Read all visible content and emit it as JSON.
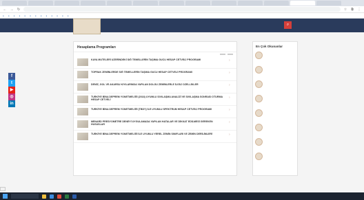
{
  "browser": {
    "tabs": [
      "",
      "",
      "",
      "",
      "",
      "",
      "",
      "",
      "",
      "",
      "",
      "",
      ""
    ],
    "active_tab": 11,
    "url": "",
    "bookmarks": [
      "",
      "",
      "",
      "",
      "",
      "",
      "",
      "",
      "",
      "",
      "",
      "",
      ""
    ]
  },
  "site": {
    "logo_text": "",
    "menu": [
      "",
      "",
      "",
      "",
      "",
      "",
      ""
    ],
    "search_icon": "search-icon",
    "breadcrumb": ""
  },
  "main": {
    "title": "Hesaplama Programları",
    "filter_label": "",
    "sort_a": "",
    "sort_b": "",
    "items": [
      {
        "title": "KAYA MÜTELERİ ÜZERİNDEKİ SIĞ TEMELLERİN TAŞIMA GÜCÜ HESAP CETVELİ PROGRAMI",
        "date": ""
      },
      {
        "title": "TOPRAK ZEMİNLERDE SIĞ TEMELLERİN TAŞIMA GÜCÜ HESAP CETVELİ PROGRAMI",
        "date": ""
      },
      {
        "title": "DENİZ, GÖL VE AKARSU KIYILARINDA YAPILAN DOLGU ZEMİNLERLE İLGİLİ ÖZELLİKLER",
        "date": ""
      },
      {
        "title": "TÜRKİYE BİNA DEPREM YÖNETMELİĞİ (2018) UYUMLU SIVILAŞMA ANALİZİ VE SIVILAŞMA SONRASI OTURMA HESAP CETVELİ",
        "date": ""
      },
      {
        "title": "TÜRKİYE BİNA DEPREM YÖNETMELİĞİ (TBDY) İLE UYUMLU SPEKTRUM HESAP CETVELİ PROGRAMI",
        "date": ""
      },
      {
        "title": "MENARD PRESYOMETRE DENEYİ UYGULAMADA YAPILAN HATALAR VE DİKKAT EDİLMESİ GEREKEN HUSUSLAR",
        "date": ""
      },
      {
        "title": "TÜRKİYE BİNA DEPREM YÖNETMELİĞİ İLE UYUMLU YEREL ZEMİN SINIFLARI VE ZEMİN DERİLİMLERİ",
        "date": ""
      }
    ]
  },
  "sidebar": {
    "title": "En Çok Okunanlar",
    "items": [
      {
        "name": "",
        "tag": ""
      },
      {
        "name": "",
        "tag": ""
      },
      {
        "name": "",
        "tag": ""
      },
      {
        "name": "",
        "tag": ""
      },
      {
        "name": "",
        "tag": ""
      },
      {
        "name": "",
        "tag": ""
      },
      {
        "name": "",
        "tag": ""
      },
      {
        "name": "",
        "tag": ""
      }
    ]
  },
  "social": [
    {
      "icon": "facebook-icon",
      "glyph": "f",
      "color": "#3b5998"
    },
    {
      "icon": "twitter-icon",
      "glyph": "t",
      "color": "#1da1f2"
    },
    {
      "icon": "youtube-icon",
      "glyph": "▶",
      "color": "#e62117"
    },
    {
      "icon": "instagram-icon",
      "glyph": "◎",
      "color": "#c13584"
    },
    {
      "icon": "linkedin-icon",
      "glyph": "in",
      "color": "#0077b5"
    }
  ],
  "status_url": "",
  "taskbar": {
    "search_placeholder": "",
    "clock": ""
  }
}
